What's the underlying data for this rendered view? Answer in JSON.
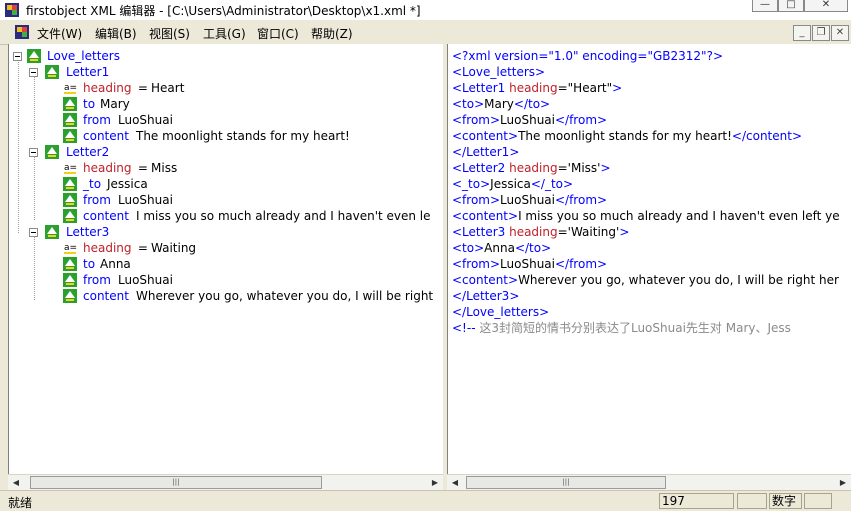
{
  "window": {
    "title": "firstobject XML 编辑器 - [C:\\Users\\Administrator\\Desktop\\x1.xml *]",
    "minimize": "—",
    "restore": "□",
    "close": "✕"
  },
  "menu": {
    "items": [
      "文件(W)",
      "编辑(B)",
      "视图(S)",
      "工具(G)",
      "窗口(C)",
      "帮助(Z)"
    ]
  },
  "mdi": {
    "minimize": "_",
    "restore": "❐",
    "close": "✕"
  },
  "tree": {
    "root": "Love_letters",
    "letters": [
      {
        "name": "Letter1",
        "attr_name": "heading",
        "attr_eq": " = ",
        "attr_value": "Heart",
        "to_tag": "to",
        "to_value": "Mary",
        "from_tag": "from",
        "from_value": "LuoShuai",
        "content_tag": "content",
        "content_value": "The moonlight stands for my heart!"
      },
      {
        "name": "Letter2",
        "attr_name": "heading",
        "attr_eq": " = ",
        "attr_value": "Miss",
        "to_tag": "_to",
        "to_value": "Jessica",
        "from_tag": "from",
        "from_value": "LuoShuai",
        "content_tag": "content",
        "content_value": "I miss you so much already and I haven't even le"
      },
      {
        "name": "Letter3",
        "attr_name": "heading",
        "attr_eq": " = ",
        "attr_value": "Waiting",
        "to_tag": "to",
        "to_value": "Anna",
        "from_tag": "from",
        "from_value": "LuoShuai",
        "content_tag": "content",
        "content_value": "Wherever you go, whatever you do, I will be right"
      }
    ]
  },
  "source": {
    "lines": [
      [
        {
          "t": "<?xml version=\"1.0\" encoding=\"GB2312\"?>",
          "c": "blue"
        }
      ],
      [
        {
          "t": "<Love_letters>",
          "c": "blue"
        }
      ],
      [
        {
          "t": "<Letter1 ",
          "c": "blue"
        },
        {
          "t": "heading",
          "c": "red"
        },
        {
          "t": "=\"Heart\"",
          "c": "black"
        },
        {
          "t": ">",
          "c": "blue"
        }
      ],
      [
        {
          "t": "<to>",
          "c": "blue"
        },
        {
          "t": "Mary",
          "c": "black"
        },
        {
          "t": "</to>",
          "c": "blue"
        }
      ],
      [
        {
          "t": "<from>",
          "c": "blue"
        },
        {
          "t": "LuoShuai",
          "c": "black"
        },
        {
          "t": "</from>",
          "c": "blue"
        }
      ],
      [
        {
          "t": "<content>",
          "c": "blue"
        },
        {
          "t": "The moonlight stands for my heart!",
          "c": "black"
        },
        {
          "t": "</content>",
          "c": "blue"
        }
      ],
      [
        {
          "t": "</Letter1>",
          "c": "blue"
        }
      ],
      [
        {
          "t": "<Letter2 ",
          "c": "blue"
        },
        {
          "t": "heading",
          "c": "red"
        },
        {
          "t": "='Miss'",
          "c": "black"
        },
        {
          "t": ">",
          "c": "blue"
        }
      ],
      [
        {
          "t": "<_to>",
          "c": "blue"
        },
        {
          "t": "Jessica",
          "c": "black"
        },
        {
          "t": "</_to>",
          "c": "blue"
        }
      ],
      [
        {
          "t": "<from>",
          "c": "blue"
        },
        {
          "t": "LuoShuai",
          "c": "black"
        },
        {
          "t": "</from>",
          "c": "blue"
        }
      ],
      [
        {
          "t": "<content>",
          "c": "blue"
        },
        {
          "t": "I miss you so much already and I haven't even left ye",
          "c": "black"
        }
      ],
      [
        {
          "t": "<Letter3 ",
          "c": "blue"
        },
        {
          "t": "heading",
          "c": "red"
        },
        {
          "t": "='Waiting'",
          "c": "black"
        },
        {
          "t": ">",
          "c": "blue"
        }
      ],
      [
        {
          "t": "<to>",
          "c": "blue"
        },
        {
          "t": "Anna",
          "c": "black"
        },
        {
          "t": "</to>",
          "c": "blue"
        }
      ],
      [
        {
          "t": "<from>",
          "c": "blue"
        },
        {
          "t": "LuoShuai",
          "c": "black"
        },
        {
          "t": "</from>",
          "c": "blue"
        }
      ],
      [
        {
          "t": "<content>",
          "c": "blue"
        },
        {
          "t": "Wherever you go, whatever you do, I will be right her",
          "c": "black"
        }
      ],
      [
        {
          "t": "</Letter3>",
          "c": "blue"
        }
      ],
      [
        {
          "t": "</Love_letters>",
          "c": "blue"
        }
      ],
      [
        {
          "t": "<!-- ",
          "c": "blue"
        },
        {
          "t": "这3封简短的情书分别表达了LuoShuai先生对 Mary、Jess",
          "c": "gray"
        }
      ]
    ]
  },
  "status": {
    "text": "就绪",
    "position": "197",
    "mode": "数字"
  },
  "colors": {
    "tag": "#0000ff",
    "attr": "#c0202a",
    "comment": "#8a8a8a"
  }
}
